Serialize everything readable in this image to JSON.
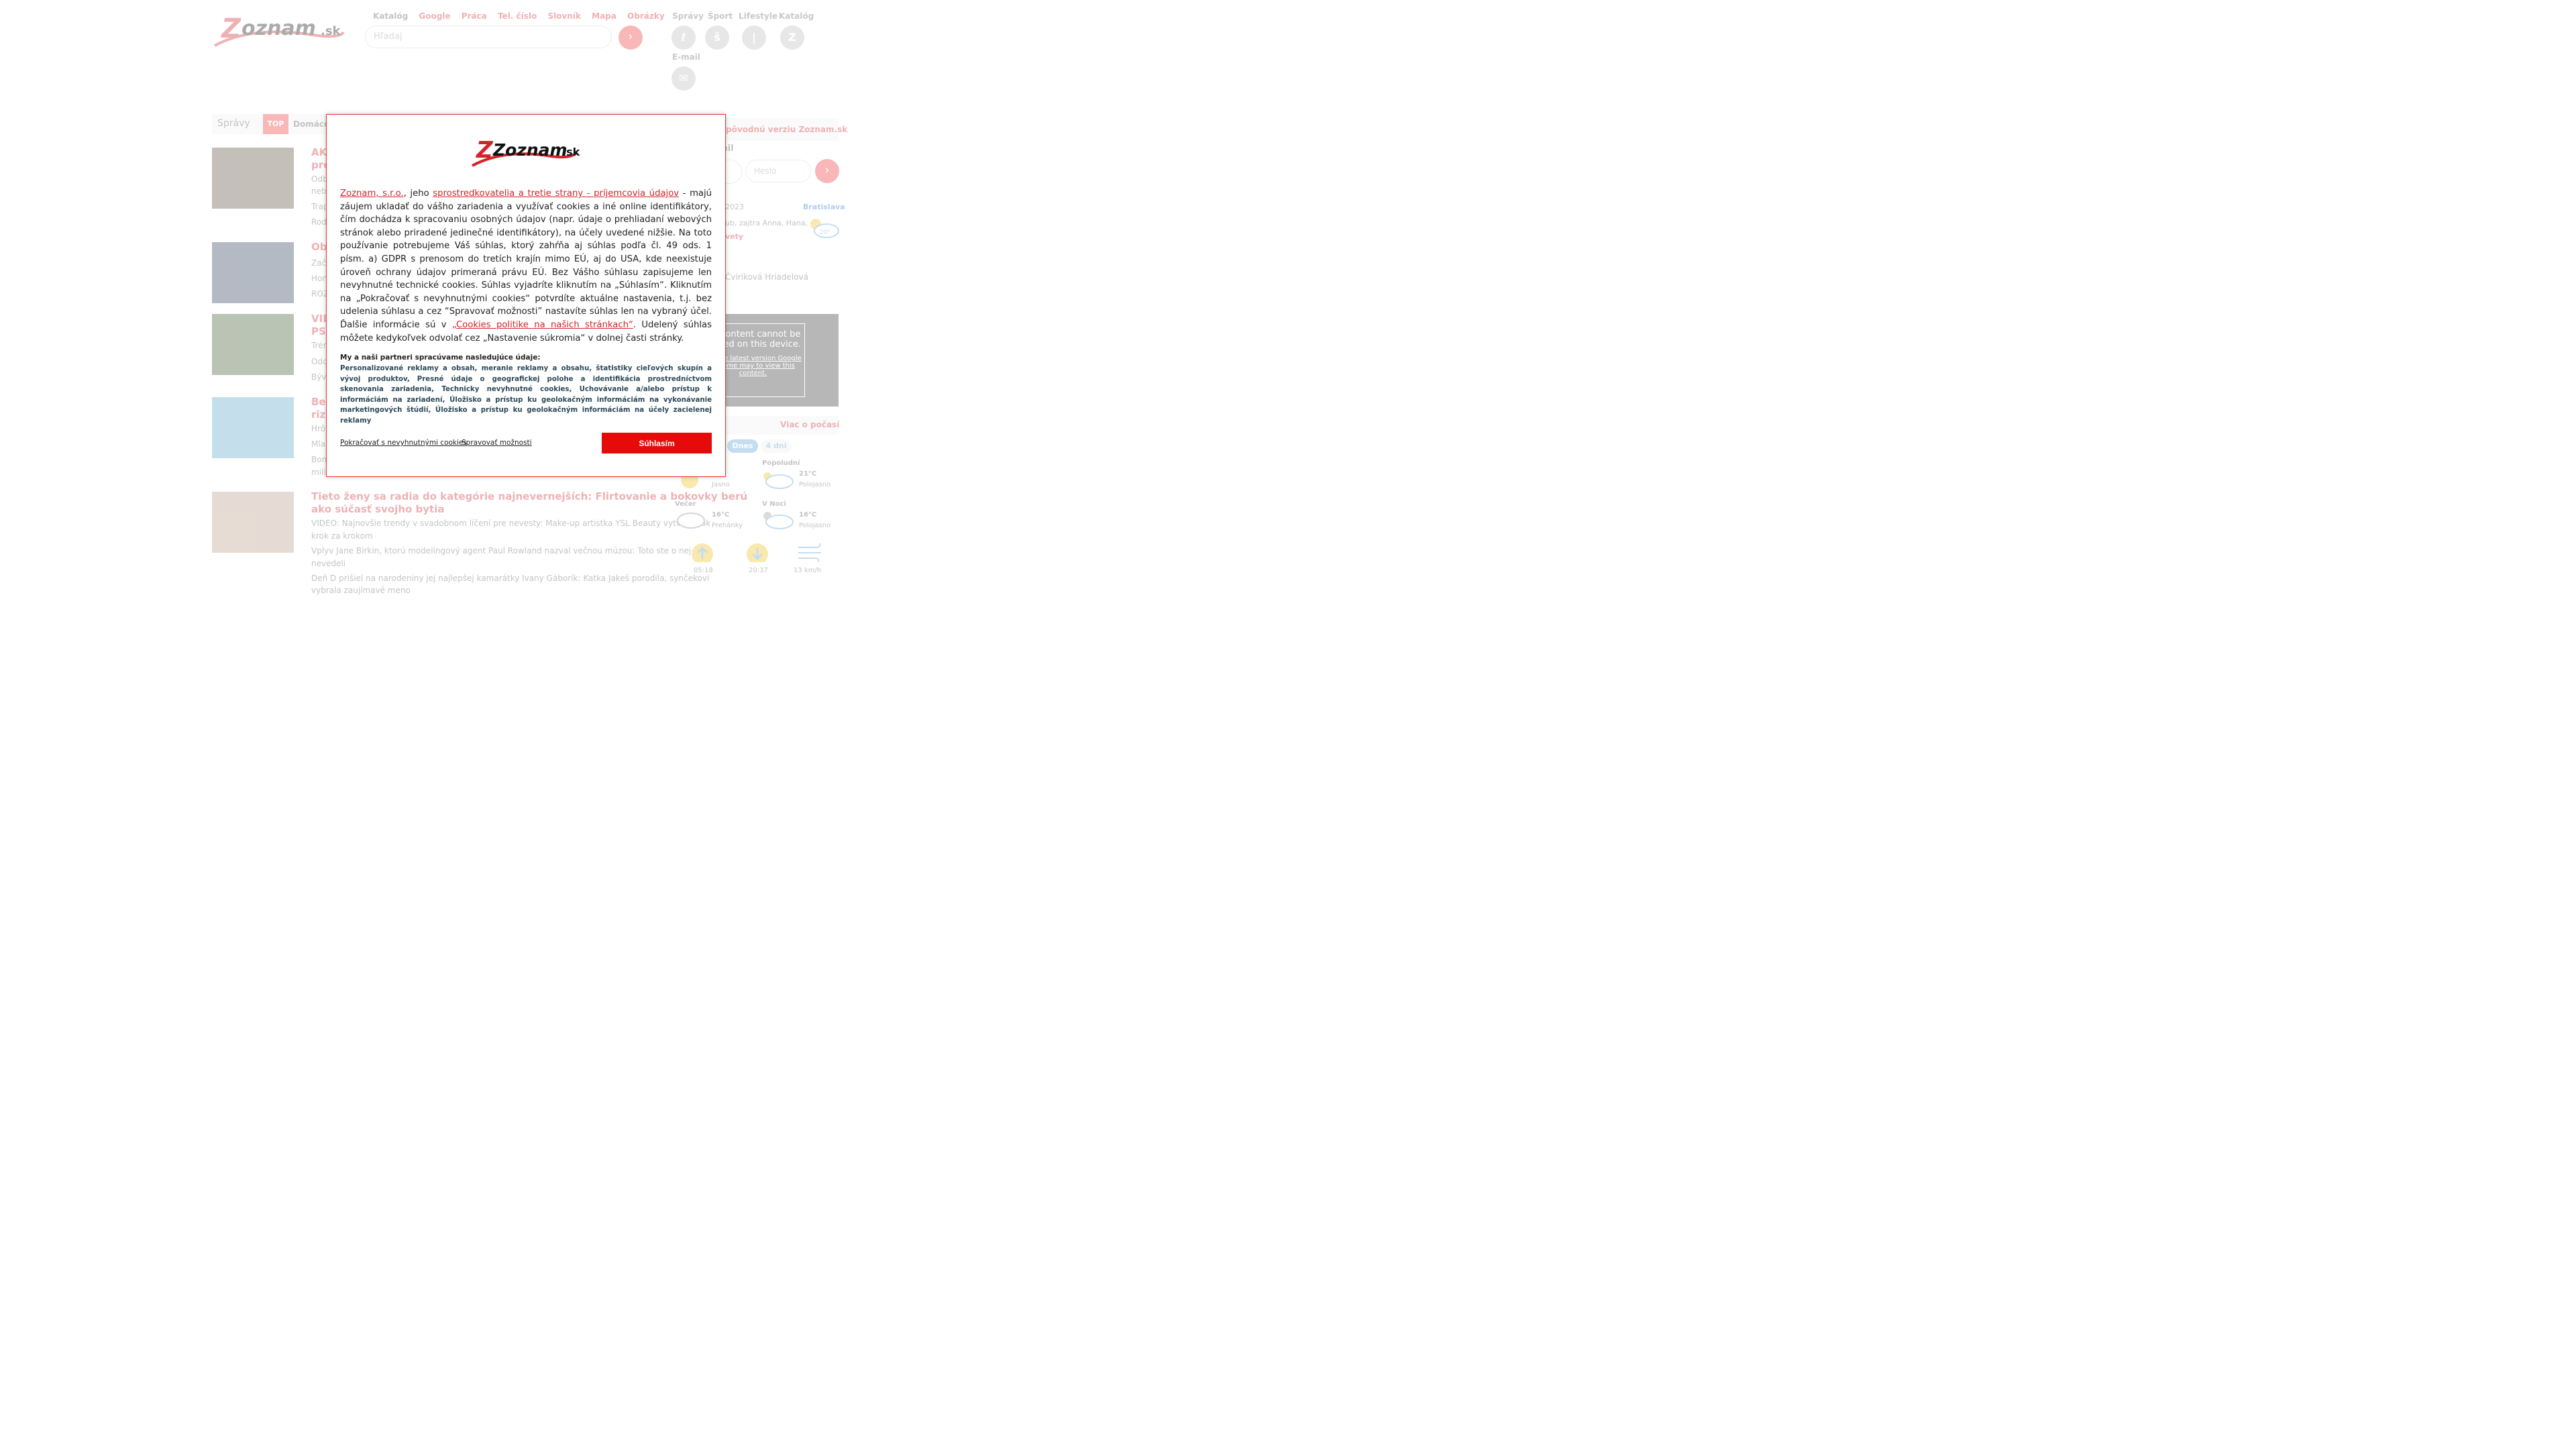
{
  "header": {
    "top_links": [
      "Katalóg",
      "Google",
      "Práca",
      "Tel. číslo",
      "Slovník",
      "Mapa",
      "Obrázky"
    ],
    "search_placeholder": "Hľadaj",
    "services": [
      {
        "label": "Správy",
        "icon": "ℓ"
      },
      {
        "label": "Šport",
        "icon": "š"
      },
      {
        "label": "Lifestyle",
        "icon": "|"
      },
      {
        "label": "Katalóg",
        "icon": "Z"
      },
      {
        "label": "E-mail",
        "icon": "✉"
      }
    ]
  },
  "nav": {
    "label": "Správy",
    "top": "TOP",
    "domace": "Domáce"
  },
  "articles": [
    {
      "title": "AKT…",
      "title2": "pre…",
      "subs": [
        "Odb…",
        "neb…",
        "Trap…",
        "Rod…"
      ]
    },
    {
      "title": "Oba…",
      "subs": [
        "Zač…",
        "Hon…",
        "ROZ…"
      ]
    },
    {
      "title": "VID…",
      "title2": "PSG…",
      "subs": [
        "Trén…",
        "Odd…",
        "Býv…"
      ]
    },
    {
      "title": "Ber…",
      "title2": "rizi…",
      "subs": [
        "Hrô…",
        "Mla…",
        "Bom…",
        "mili…"
      ]
    },
    {
      "title": "Tieto ženy sa radia do kategórie najnevernejších: Flirtovanie a bokovky berú",
      "title2": "ako súčasť svojho bytia",
      "subs": [
        "VIDEO: Najnovšie trendy v svadobnom líčení pre nevesty: Make-up artistka YSL Beauty vytvorí look",
        "krok za krokom",
        "Vplyv Jane Birkin, ktorú modelingový agent Paul Rowland nazval večnou múzou: Toto ste o nej",
        "nevedeli",
        "Deň D prišiel na narodeniny jej najlepšej kamarátky Ivany Gáborík: Katka Jakeš porodila, synčekovi",
        "vybrala zaujímavé meno"
      ]
    }
  ],
  "right": {
    "orig_version": "pôvodnú verziu Zoznam.sk",
    "mail_label": "ail",
    "password_placeholder": "Heslo",
    "date_text": "2023",
    "city": "Bratislava",
    "names_text": "ub, zajtra Anna, Hana,",
    "flowers": "vety",
    "temp_now": "20°",
    "author": "Čvíriková Hriadelová",
    "video_msg": "his content cannot be played on this device.",
    "video_sub": "ing the latest version Google Chrome may to view this content.",
    "more_weather": "Viac o počasí",
    "tabs": [
      "Dnes",
      "4 dni"
    ],
    "weather": [
      {
        "period": "",
        "temp": "",
        "desc": "Jasno"
      },
      {
        "period": "Popoludní",
        "temp": "21°C",
        "desc": "Polojasno"
      },
      {
        "period": "Večer",
        "temp": "16°C",
        "desc": "Prehánky"
      },
      {
        "period": "V Noci",
        "temp": "16°C",
        "desc": "Polojasno"
      }
    ],
    "sunrise": "05:18",
    "sunset": "20:37",
    "wind": "13 km/h"
  },
  "modal": {
    "logo_text": "Zoznam",
    "logo_suffix": ".sk",
    "intro_link1": "Zoznam, s.r.o.",
    "intro_part1": ", jeho ",
    "intro_link2": "sprostredkovatelia a tretie strany - príjemcovia údajov",
    "intro_part2": " - majú záujem ukladať do vášho zariadenia a využívať cookies a iné online identifikátory, čím dochádza k spracovaniu osobných údajov (napr. údaje o prehliadaní webových stránok alebo priradené jedinečné identifikátory), na účely uvedené nižšie. Na toto používanie potrebujeme Váš súhlas, ktorý zahŕňa aj súhlas podľa čl. 49 ods. 1 písm. a) GDPR s prenosom do tretích krajín mimo EÚ, aj do USA, kde neexistuje úroveň ochrany údajov primeraná právu EÚ. Bez Vášho súhlasu zapisujeme len nevyhnutné technické cookies. Súhlas vyjadríte kliknutím na „Súhlasím“. Kliknutím na „Pokračovať s nevyhnutnými cookies“ potvrdíte aktuálne nastavenia, t.j. bez udelenia súhlasu a cez “Spravovať možnosti” nastavíte súhlas len na vybraný účel. Ďalšie informácie sú v ",
    "intro_link3": "„Cookies politike na našich stránkach“",
    "intro_part3": ". Udelený súhlas môžete kedykoľvek odvolať cez „Nastavenie súkromia“ v dolnej časti stránky.",
    "purposes_heading": "My a naši partneri spracúvame nasledujúce údaje:",
    "purposes_text": "Personalizované reklamy a obsah, meranie reklamy a obsahu, štatistiky cieľových skupín a vývoj produktov, Presné údaje o geografickej polohe a identifikácia prostredníctvom skenovania zariadenia, Technicky nevyhnutné cookies, Uchovávanie a/alebo prístup k informáciám na zariadení, Úložisko a prístup ku geolokačným informáciám na vykonávanie marketingových štúdií, Úložisko a prístup ku geolokačným informáciám na účely zacielenej reklamy",
    "continue_label": "Pokračovať s nevyhnutnými cookies",
    "manage_label": "Spravovať možnosti",
    "accept_label": "Súhlasím"
  },
  "colors": {
    "brand_red": "#d2232a",
    "accept_red": "#e50b0b",
    "purpose_text": "#2d4a58"
  }
}
